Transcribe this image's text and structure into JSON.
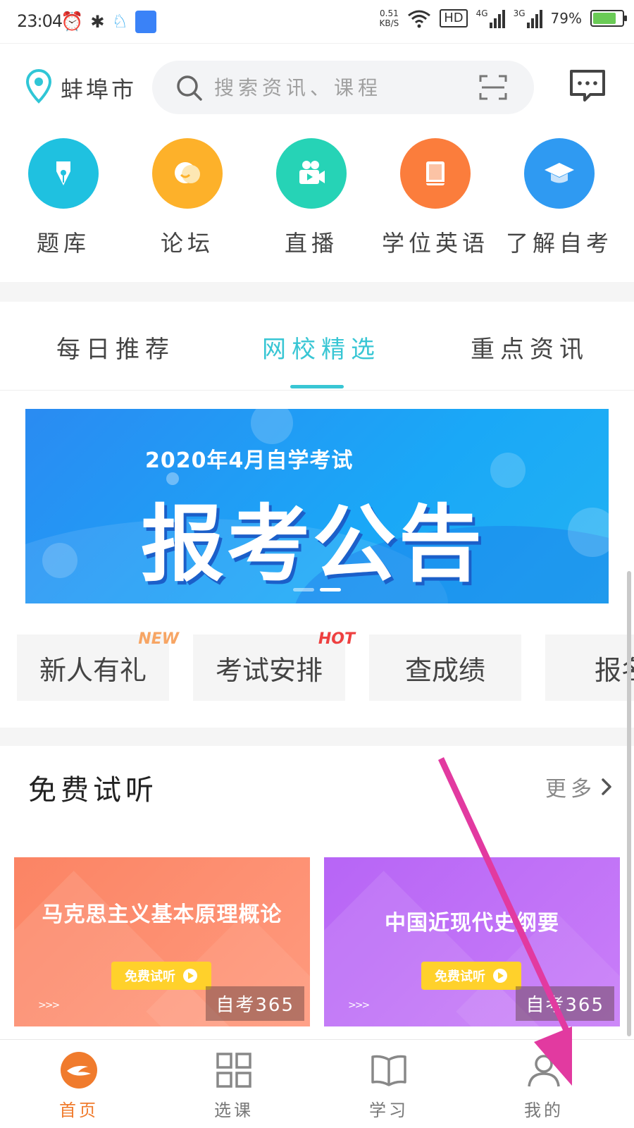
{
  "status_bar": {
    "time": "23:04",
    "net_speed": "0.51",
    "net_unit": "KB/S",
    "hd": "HD",
    "sim1": "4G",
    "sim2": "3G",
    "battery": "79%",
    "battery_level": 0.79
  },
  "header": {
    "city": "蚌埠市",
    "search_placeholder": "搜索资讯、课程"
  },
  "categories": [
    {
      "label": "题库",
      "icon": "pen-nib-icon",
      "color": "#1fc1e0"
    },
    {
      "label": "论坛",
      "icon": "chat-bubbles-icon",
      "color": "#fdb12a"
    },
    {
      "label": "直播",
      "icon": "video-camera-icon",
      "color": "#26d3b6"
    },
    {
      "label": "学位英语",
      "icon": "book-icon",
      "color": "#fb7d3c"
    },
    {
      "label": "了解自考",
      "icon": "graduation-cap-icon",
      "color": "#2f9af2"
    }
  ],
  "tabs": [
    {
      "label": "每日推荐",
      "active": false
    },
    {
      "label": "网校精选",
      "active": true
    },
    {
      "label": "重点资讯",
      "active": false
    }
  ],
  "banner": {
    "subtitle": "2020年4月自学考试",
    "title": "报考公告",
    "slides": 2,
    "active_slide": 1
  },
  "quick_actions": [
    {
      "label": "新人有礼",
      "badge": "NEW",
      "badge_color": "#f7a564"
    },
    {
      "label": "考试安排",
      "badge": "HOT",
      "badge_color": "#ee4040"
    },
    {
      "label": "查成绩",
      "badge": ""
    },
    {
      "label": "报名",
      "badge": ""
    }
  ],
  "free_trial": {
    "title": "免费试听",
    "more": "更多",
    "courses": [
      {
        "title": "马克思主义基本原理概论",
        "button": "免费试听",
        "watermark": "自考365",
        "color_from": "#fb8464",
        "color_to": "#ff9a7e"
      },
      {
        "title": "中国近现代史纲要",
        "button": "免费试听",
        "watermark": "自考365",
        "color_from": "#b765f6",
        "color_to": "#c97ef8"
      }
    ]
  },
  "bottom_nav": [
    {
      "label": "首页",
      "icon": "home-logo-icon",
      "active": true
    },
    {
      "label": "选课",
      "icon": "grid-icon",
      "active": false
    },
    {
      "label": "学习",
      "icon": "open-book-icon",
      "active": false
    },
    {
      "label": "我的",
      "icon": "profile-icon",
      "active": false
    }
  ],
  "colors": {
    "accent": "#38c6d4",
    "nav_active": "#f07b2d",
    "annotation_arrow": "#e23aa0"
  }
}
